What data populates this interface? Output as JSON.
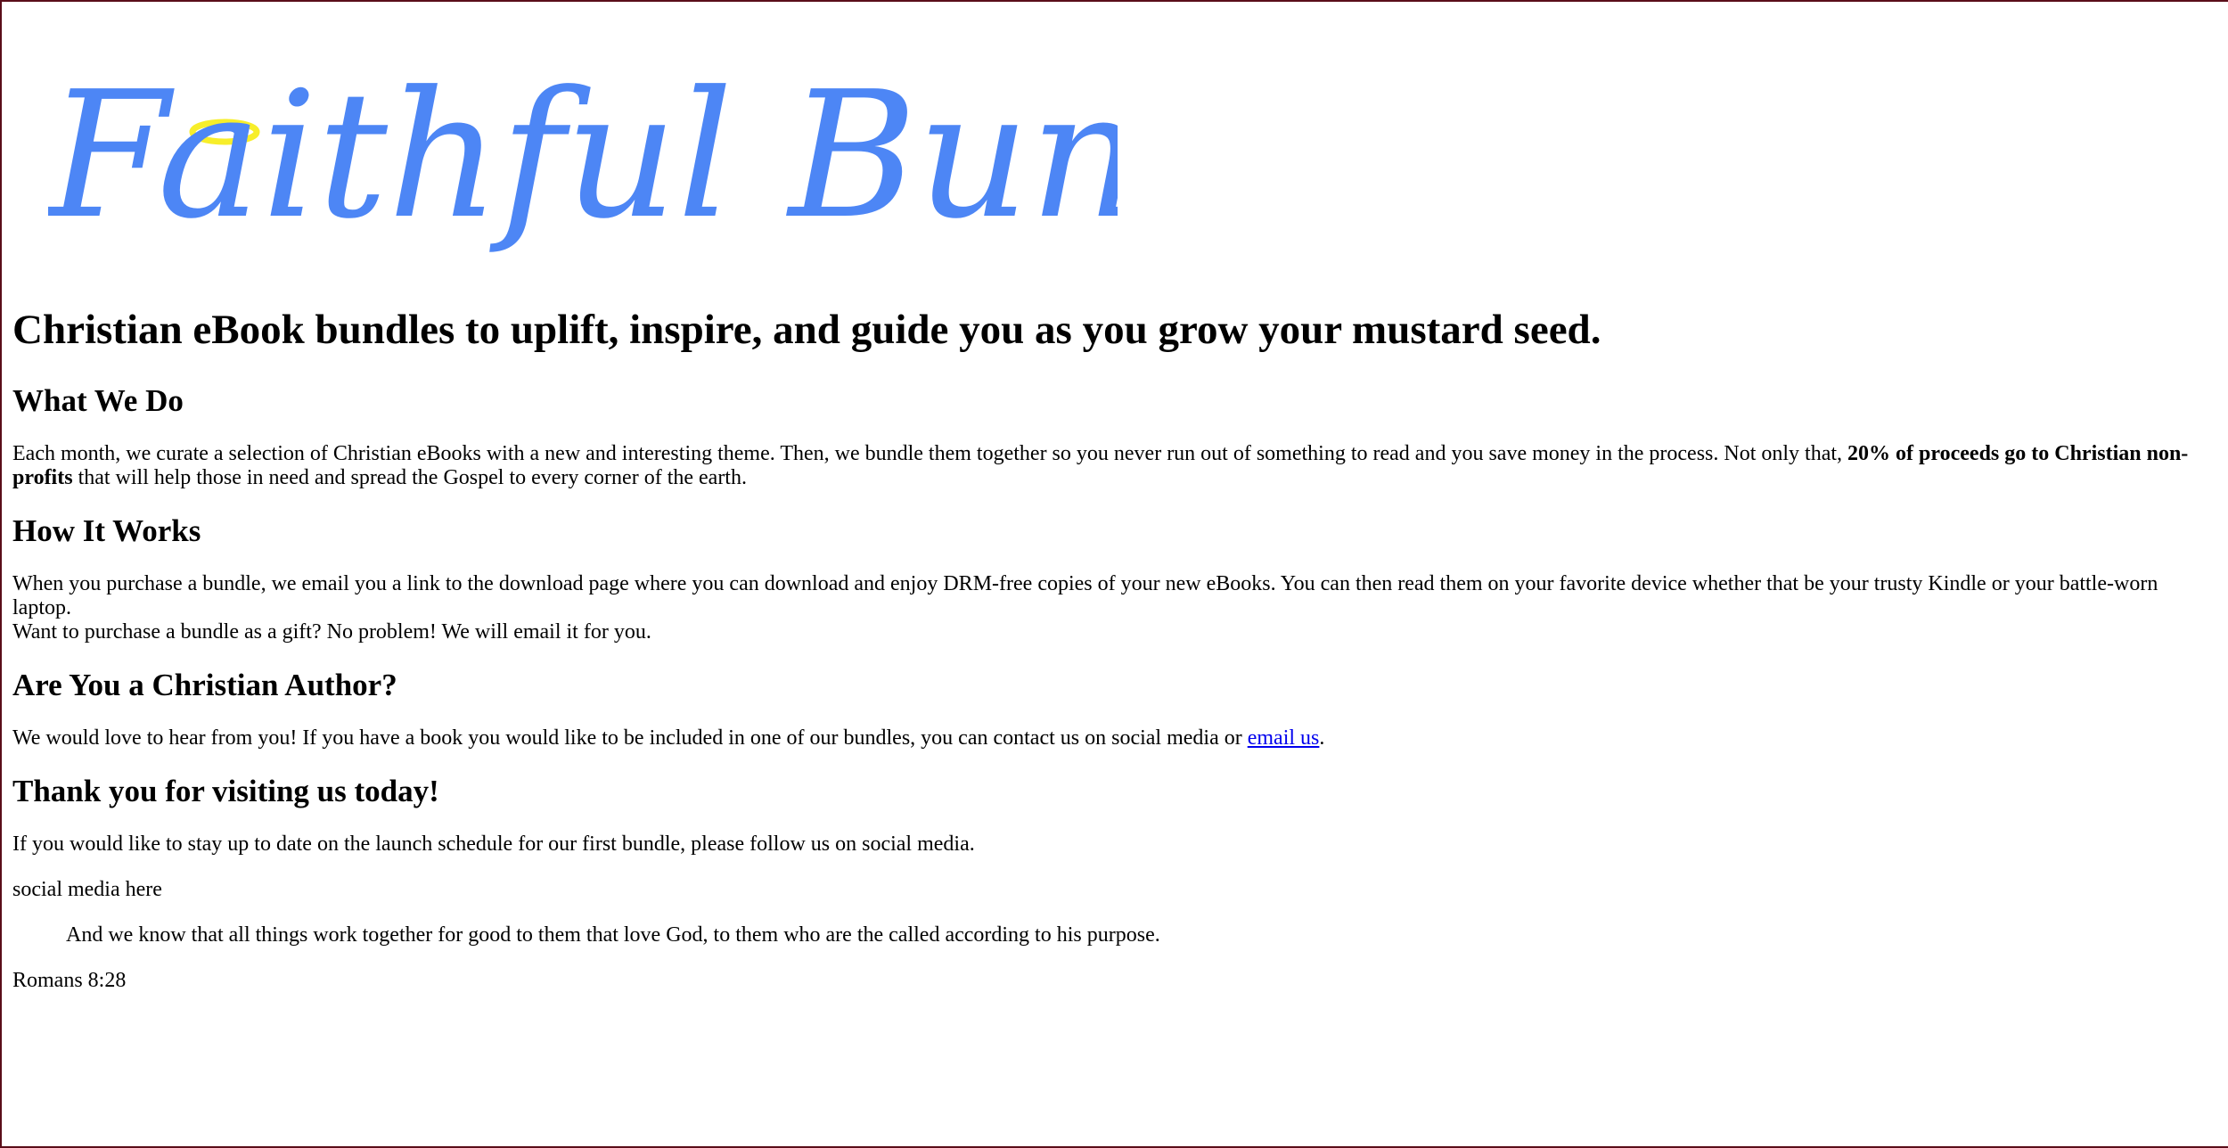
{
  "logo": {
    "text": "Faithful Bundles",
    "text_color": "#4d86f5",
    "halo_color": "#f7ee2a"
  },
  "hero": {
    "headline": "Christian eBook bundles to uplift, inspire, and guide you as you grow your mustard seed."
  },
  "what_we_do": {
    "heading": "What We Do",
    "text_before": "Each month, we curate a selection of Christian eBooks with a new and interesting theme. Then, we bundle them together so you never run out of something to read and you save money in the process. Not only that, ",
    "bold_text": "20% of proceeds go to Christian non-profits",
    "text_after": " that will help those in need and spread the Gospel to every corner of the earth."
  },
  "how_it_works": {
    "heading": "How It Works",
    "line1": "When you purchase a bundle, we email you a link to the download page where you can download and enjoy DRM-free copies of your new eBooks. You can then read them on your favorite device whether that be your trusty Kindle or your battle-worn laptop.",
    "line2": "Want to purchase a bundle as a gift? No problem! We will email it for you."
  },
  "author": {
    "heading": "Are You a Christian Author?",
    "text_before": "We would love to hear from you! If you have a book you would like to be included in one of our bundles, you can contact us on social media or ",
    "link_label": "email us",
    "text_after": "."
  },
  "thanks": {
    "heading": "Thank you for visiting us today!",
    "text": "If you would like to stay up to date on the launch schedule for our first bundle, please follow us on social media.",
    "social_placeholder": "social media here"
  },
  "verse": {
    "quote": "And we know that all things work together for good to them that love God, to them who are the called according to his purpose.",
    "citation": "Romans 8:28"
  },
  "colors": {
    "link": "#0000ee",
    "frame_border": "#5a0e1a"
  }
}
